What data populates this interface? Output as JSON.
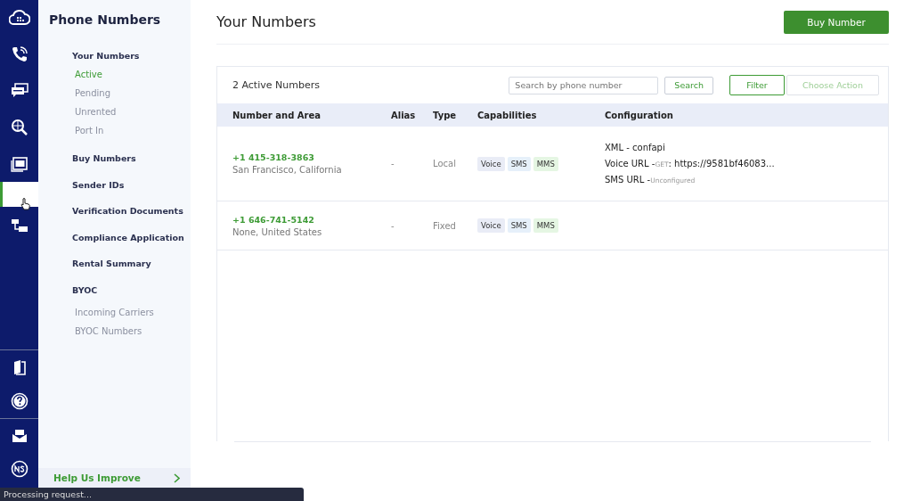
{
  "rail": {
    "top": [
      {
        "kind": "cloud",
        "selected": false
      },
      {
        "kind": "phone",
        "selected": false
      },
      {
        "kind": "chat",
        "selected": false
      },
      {
        "kind": "globe-search",
        "selected": false
      },
      {
        "kind": "sip",
        "selected": false
      },
      {
        "kind": "pointer",
        "selected": true
      },
      {
        "kind": "flow",
        "selected": false
      }
    ],
    "bottom": [
      {
        "kind": "book",
        "selected": false
      },
      {
        "kind": "help",
        "selected": false
      },
      {
        "kind": "mail",
        "selected": false
      },
      {
        "kind": "ns",
        "selected": false
      }
    ]
  },
  "sidebar": {
    "title": "Phone Numbers",
    "items": [
      {
        "label": "Your Numbers",
        "selected": false,
        "children": [
          {
            "label": "Active",
            "selected": true
          },
          {
            "label": "Pending",
            "selected": false
          },
          {
            "label": "Unrented",
            "selected": false
          },
          {
            "label": "Port In",
            "selected": false
          }
        ]
      },
      {
        "label": "Buy Numbers",
        "selected": false
      },
      {
        "label": "Sender IDs",
        "selected": false
      },
      {
        "label": "Verification Documents",
        "selected": false
      },
      {
        "label": "Compliance Application",
        "selected": false
      },
      {
        "label": "Rental Summary",
        "selected": false
      },
      {
        "label": "BYOC",
        "selected": false,
        "children": [
          {
            "label": "Incoming Carriers",
            "selected": false
          },
          {
            "label": "BYOC Numbers",
            "selected": false
          }
        ]
      }
    ],
    "footer": "Help Us Improve"
  },
  "page": {
    "title": "Your Numbers",
    "button": "Buy Number"
  },
  "card": {
    "count": "2 Active Numbers",
    "search": {
      "placeholder": "Search by phone number"
    },
    "search_button": "Search",
    "filter_button": "Filter",
    "action_button": {
      "label": "Choose Action",
      "disabled": true
    }
  },
  "table": {
    "columns": [
      "Number and Area",
      "Alias",
      "Type",
      "Capabilities",
      "Configuration"
    ],
    "rows": [
      {
        "number": "+1 415-318-3863",
        "area": "San Francisco, California",
        "alias": "-",
        "type": "Local",
        "capabilities": [
          {
            "label": "Voice",
            "color": "#e9ecf6"
          },
          {
            "label": "SMS",
            "color": "#e6f0fa"
          },
          {
            "label": "MMS",
            "color": "#e5f6e3"
          }
        ],
        "configuration": [
          {
            "label": "XML - confapi"
          },
          {
            "label": "Voice URL -",
            "note": "GET",
            "value": ": https://9581bf46083..."
          },
          {
            "label": "SMS URL -",
            "note": "Unconfigured"
          }
        ]
      },
      {
        "number": "+1 646-741-5142",
        "area": "None, United States",
        "alias": "-",
        "type": "Fixed",
        "capabilities": [
          {
            "label": "Voice",
            "color": "#e9ecf6"
          },
          {
            "label": "SMS",
            "color": "#e6f0fa"
          },
          {
            "label": "MMS",
            "color": "#e5f6e3"
          }
        ]
      }
    ]
  },
  "status_bar": "Processing request..."
}
